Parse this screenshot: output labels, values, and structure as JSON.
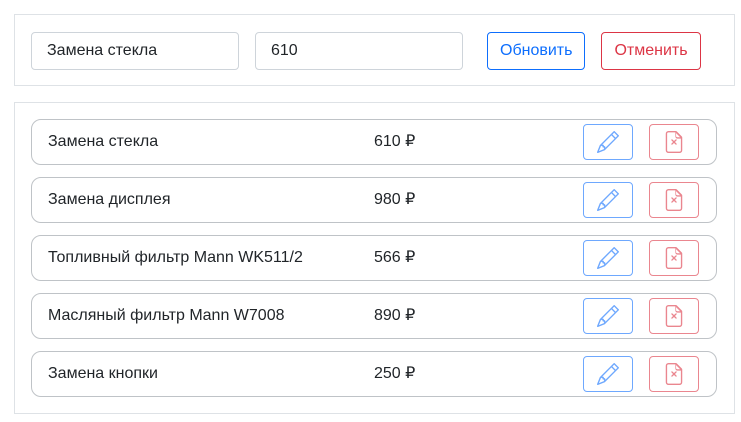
{
  "form": {
    "name_value": "Замена стекла",
    "price_value": "610",
    "update_label": "Обновить",
    "cancel_label": "Отменить"
  },
  "items": [
    {
      "name": "Замена стекла",
      "price": "610 ₽"
    },
    {
      "name": "Замена дисплея",
      "price": "980 ₽"
    },
    {
      "name": "Топливный фильтр Mann WK511/2",
      "price": "566 ₽"
    },
    {
      "name": "Масляный фильтр Mann W7008",
      "price": "890 ₽"
    },
    {
      "name": "Замена кнопки",
      "price": "250 ₽"
    }
  ],
  "icons": {
    "edit": "pencil-icon",
    "delete": "file-x-icon"
  },
  "colors": {
    "primary": "#0d6efd",
    "danger": "#dc3545",
    "edit_outline": "#6ea8fe",
    "delete_outline": "#ea868f"
  }
}
